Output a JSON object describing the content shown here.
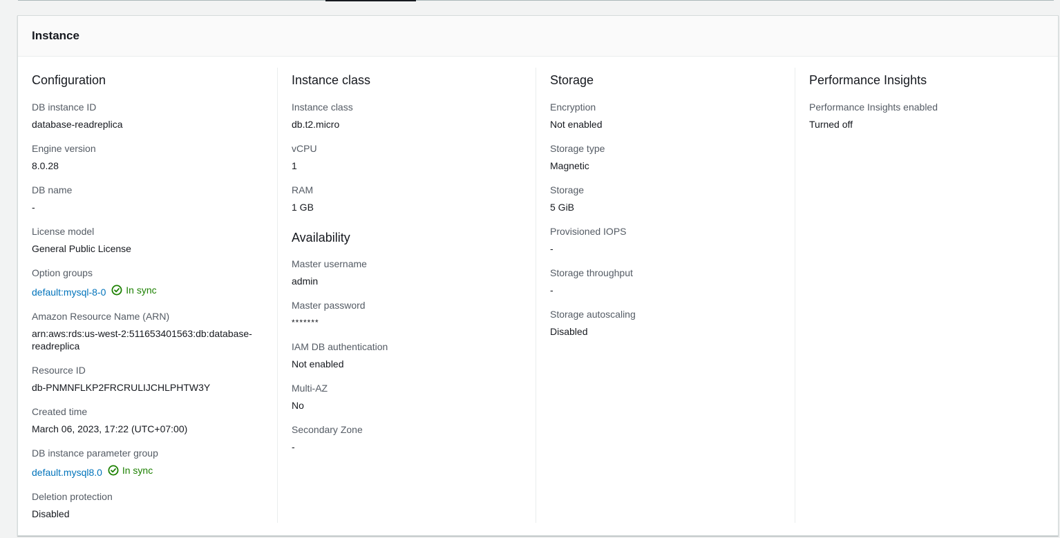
{
  "panel": {
    "title": "Instance"
  },
  "configuration": {
    "title": "Configuration",
    "db_instance_id": {
      "label": "DB instance ID",
      "value": "database-readreplica"
    },
    "engine_version": {
      "label": "Engine version",
      "value": "8.0.28"
    },
    "db_name": {
      "label": "DB name",
      "value": "-"
    },
    "license_model": {
      "label": "License model",
      "value": "General Public License"
    },
    "option_groups": {
      "label": "Option groups",
      "link": "default:mysql-8-0",
      "status": "In sync"
    },
    "arn": {
      "label": "Amazon Resource Name (ARN)",
      "value": "arn:aws:rds:us-west-2:511653401563:db:database-readreplica"
    },
    "resource_id": {
      "label": "Resource ID",
      "value": "db-PNMNFLKP2FRCRULIJCHLPHTW3Y"
    },
    "created_time": {
      "label": "Created time",
      "value": "March 06, 2023, 17:22 (UTC+07:00)"
    },
    "parameter_group": {
      "label": "DB instance parameter group",
      "link": "default.mysql8.0",
      "status": "In sync"
    },
    "deletion_protection": {
      "label": "Deletion protection",
      "value": "Disabled"
    }
  },
  "instance_class": {
    "title": "Instance class",
    "instance_class": {
      "label": "Instance class",
      "value": "db.t2.micro"
    },
    "vcpu": {
      "label": "vCPU",
      "value": "1"
    },
    "ram": {
      "label": "RAM",
      "value": "1 GB"
    }
  },
  "availability": {
    "title": "Availability",
    "master_username": {
      "label": "Master username",
      "value": "admin"
    },
    "master_password": {
      "label": "Master password",
      "value": "*******"
    },
    "iam_auth": {
      "label": "IAM DB authentication",
      "value": "Not enabled"
    },
    "multi_az": {
      "label": "Multi-AZ",
      "value": "No"
    },
    "secondary_zone": {
      "label": "Secondary Zone",
      "value": "-"
    }
  },
  "storage": {
    "title": "Storage",
    "encryption": {
      "label": "Encryption",
      "value": "Not enabled"
    },
    "storage_type": {
      "label": "Storage type",
      "value": "Magnetic"
    },
    "storage": {
      "label": "Storage",
      "value": "5 GiB"
    },
    "provisioned_iops": {
      "label": "Provisioned IOPS",
      "value": "-"
    },
    "throughput": {
      "label": "Storage throughput",
      "value": "-"
    },
    "autoscaling": {
      "label": "Storage autoscaling",
      "value": "Disabled"
    }
  },
  "performance_insights": {
    "title": "Performance Insights",
    "enabled": {
      "label": "Performance Insights enabled",
      "value": "Turned off"
    }
  },
  "colors": {
    "link": "#0073bb",
    "success": "#1d8102",
    "label": "#545b64",
    "text": "#16191f"
  },
  "icons": {
    "sync_status": "check-circle-icon"
  }
}
